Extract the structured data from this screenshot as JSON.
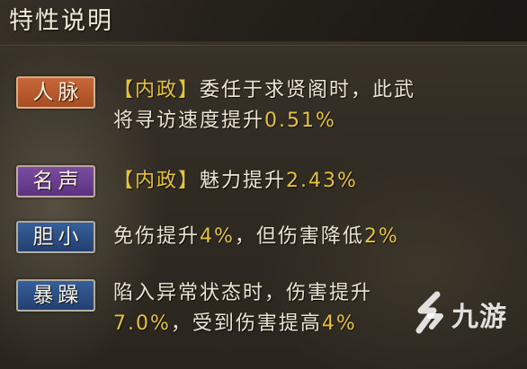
{
  "title": "特性说明",
  "colors": {
    "accent_number": "#e6c13a",
    "badge_renmai": "#b8582a",
    "badge_mingsheng": "#6a3f8c",
    "badge_danxiao": "#2b4f86",
    "badge_baozao": "#2b4f86"
  },
  "traits": [
    {
      "name": "人脉",
      "line1_tag": "【内政】",
      "line1_text": "委任于求贤阁时，此武",
      "line2_text": "将寻访速度提升",
      "line2_num": "0.51%"
    },
    {
      "name": "名声",
      "tag": "【内政】",
      "text": "魅力提升",
      "num": "2.43%"
    },
    {
      "name": "胆小",
      "text_a": "免伤提升",
      "num_a": "4%",
      "text_b": "，但伤害降低",
      "num_b": "2%"
    },
    {
      "name": "暴躁",
      "line1_text": "陷入异常状态时，伤害提升",
      "line2_num_a": "7.0%",
      "line2_text": "，受到伤害提高",
      "line2_num_b": "4%"
    }
  ],
  "watermark": {
    "logo_icon": "9you-s-logo-icon",
    "text": "九游"
  }
}
